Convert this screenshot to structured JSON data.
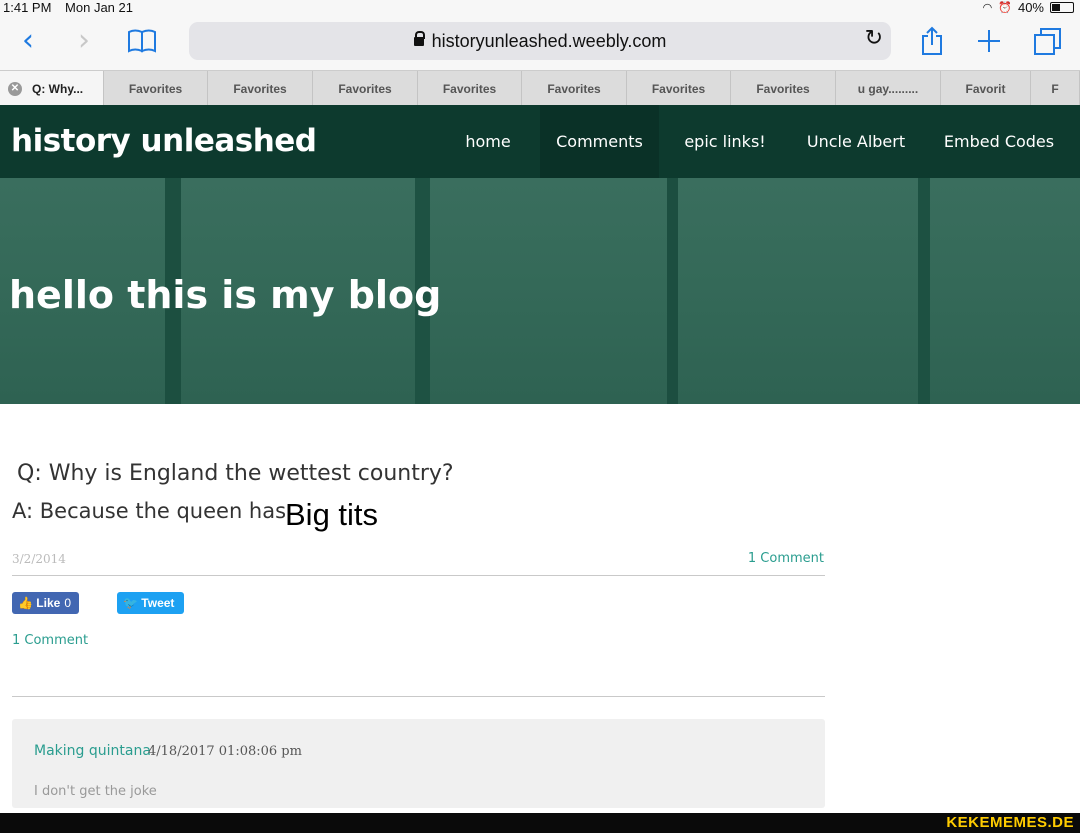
{
  "status_bar": {
    "time": "1:41 PM",
    "date": "Mon Jan 21",
    "battery": "40%",
    "battery_level": 0.4
  },
  "browser": {
    "url": "historyunleashed.weebly.com",
    "icons": {
      "back": "chevron-left-icon",
      "forward": "chevron-right-icon",
      "bookmarks": "book-icon",
      "reload": "reload-icon",
      "share": "share-icon",
      "new_tab": "plus-icon",
      "tabs": "tabs-icon"
    },
    "tabs": [
      {
        "label": "Q: Why..."
      },
      {
        "label": "Favorites"
      },
      {
        "label": "Favorites"
      },
      {
        "label": "Favorites"
      },
      {
        "label": "Favorites"
      },
      {
        "label": "Favorites"
      },
      {
        "label": "Favorites"
      },
      {
        "label": "Favorites"
      },
      {
        "label": "u gay........."
      },
      {
        "label": "Favorit"
      },
      {
        "label": "F"
      }
    ]
  },
  "site": {
    "title": "history unleashed",
    "nav": [
      {
        "label": "home"
      },
      {
        "label": "Comments"
      },
      {
        "label": "epic links!"
      },
      {
        "label": "Uncle Albert"
      },
      {
        "label": "Embed Codes"
      }
    ],
    "banner_heading": "hello this is my blog"
  },
  "post": {
    "question": "Q: Why is England the wettest country?",
    "answer": "A: Because the queen has",
    "punchline": "Big tits",
    "date": "3/2/2014",
    "comment_count": "1 Comment",
    "like_label": "Like",
    "like_count": "0",
    "tweet_label": "Tweet",
    "comments_link": "1 Comment"
  },
  "comment": {
    "author": "Making quintana",
    "timestamp": "4/18/2017 01:08:06 pm",
    "text": "I don't get the joke"
  },
  "watermark": "KEKEMEMES.DE",
  "colors": {
    "header": "#0d3a2e",
    "accent": "#2a9d8f",
    "link_blue": "#1f7ae0",
    "facebook": "#4267b2",
    "twitter": "#1da1f2"
  }
}
